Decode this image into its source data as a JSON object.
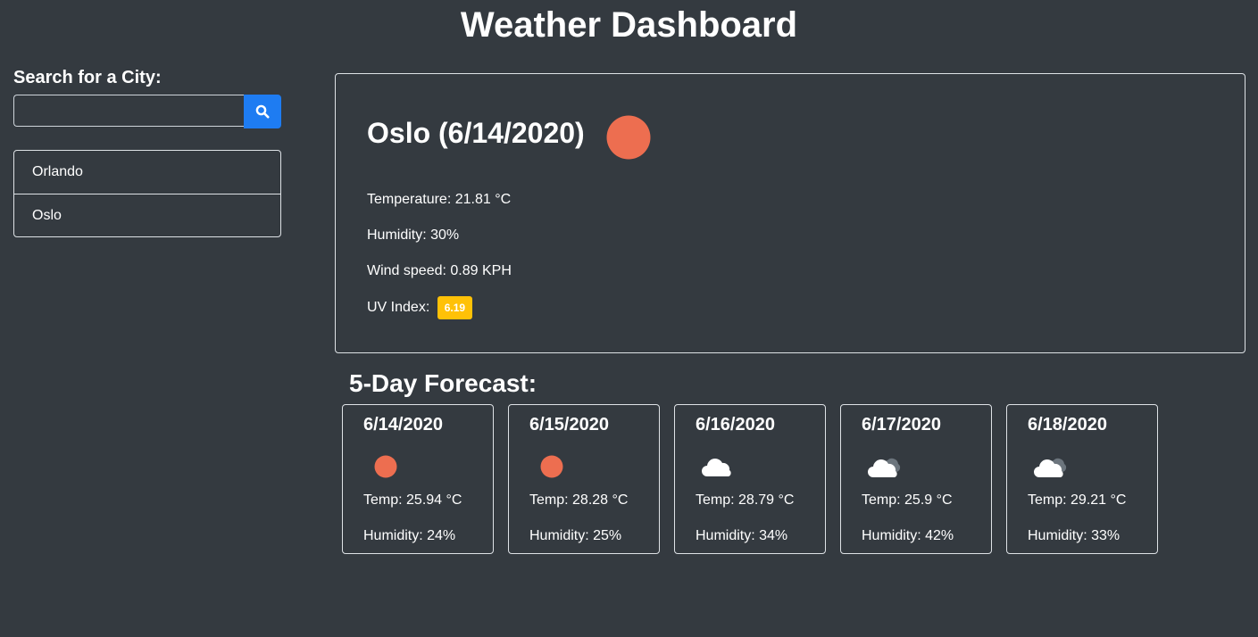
{
  "header": {
    "title": "Weather Dashboard"
  },
  "search": {
    "label": "Search for a City:",
    "value": "",
    "placeholder": "",
    "button_icon": "search-icon",
    "button_color": "#1e7cf2"
  },
  "history": {
    "items": [
      {
        "label": "Orlando"
      },
      {
        "label": "Oslo"
      }
    ]
  },
  "current": {
    "heading": "Oslo (6/14/2020)",
    "icon": "sun-icon",
    "temperature": "Temperature: 21.81 °C",
    "humidity": "Humidity: 30%",
    "wind": "Wind speed: 0.89 KPH",
    "uv_label": "UV Index:",
    "uv_value": "6.19",
    "uv_color": "#ffc107"
  },
  "forecast": {
    "title": "5-Day Forecast:",
    "days": [
      {
        "date": "6/14/2020",
        "icon": "sun-icon",
        "temp": "Temp: 25.94 °C",
        "humidity": "Humidity: 24%"
      },
      {
        "date": "6/15/2020",
        "icon": "sun-icon",
        "temp": "Temp: 28.28 °C",
        "humidity": "Humidity: 25%"
      },
      {
        "date": "6/16/2020",
        "icon": "cloud-icon",
        "temp": "Temp: 28.79 °C",
        "humidity": "Humidity: 34%"
      },
      {
        "date": "6/17/2020",
        "icon": "broken-clouds-icon",
        "temp": "Temp: 25.9 °C",
        "humidity": "Humidity: 42%"
      },
      {
        "date": "6/18/2020",
        "icon": "broken-clouds-icon",
        "temp": "Temp: 29.21 °C",
        "humidity": "Humidity: 33%"
      }
    ]
  },
  "colors": {
    "background": "#343a40",
    "sun": "#ed6e50",
    "cloud": "#ffffff",
    "cloud_dark": "#6c757d"
  }
}
